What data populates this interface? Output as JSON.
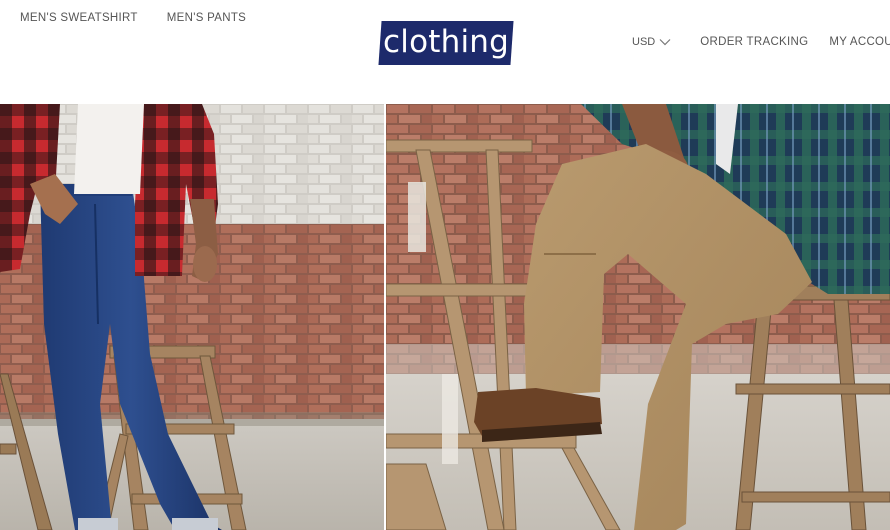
{
  "header": {
    "nav_left": [
      {
        "label": "MEN'S SWEATSHIRT"
      },
      {
        "label": "MEN'S PANTS"
      }
    ],
    "logo_text": "clothing",
    "currency": "USD",
    "nav_right": [
      {
        "label": "ORDER TRACKING"
      },
      {
        "label": "MY ACCOUNT"
      }
    ]
  },
  "colors": {
    "logo_bg": "#1d2a6b",
    "nav_text": "#555555"
  },
  "hero": {
    "left_image": "man-in-red-plaid-shirt-and-jeans",
    "right_image": "man-in-khaki-pants-sitting-on-stool"
  }
}
